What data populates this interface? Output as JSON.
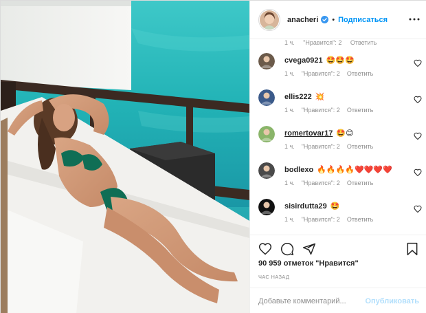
{
  "post": {
    "author": "anacheri",
    "follow_label": "Подписаться",
    "separator": "•",
    "likes_text": "90 959 отметок \"Нравится\"",
    "time_text": "час назад",
    "comment_placeholder": "Добавьте комментарий...",
    "publish_label": "Опубликовать"
  },
  "partial_comment": {
    "time": "1 ч.",
    "likes": "\"Нравится\": 2",
    "reply": "Ответить"
  },
  "comments": [
    {
      "user": "cvega0921",
      "emoji": "🤩🤩🤩",
      "time": "1 ч.",
      "likes": "\"Нравится\": 2",
      "reply": "Ответить",
      "avatar_color": "#6b5a4a",
      "underline": false
    },
    {
      "user": "ellis222",
      "emoji": "💥",
      "time": "1 ч.",
      "likes": "\"Нравится\": 2",
      "reply": "Ответить",
      "avatar_color": "#3b5a8a",
      "underline": false
    },
    {
      "user": "romertovar17",
      "emoji": "🤩😊",
      "time": "1 ч.",
      "likes": "\"Нравится\": 2",
      "reply": "Ответить",
      "avatar_color": "#8ab56a",
      "underline": true
    },
    {
      "user": "bodlexo",
      "emoji": "🔥🔥🔥🔥❤️❤️❤️❤️",
      "time": "1 ч.",
      "likes": "\"Нравится\": 2",
      "reply": "Ответить",
      "avatar_color": "#4a4a4a",
      "underline": false
    },
    {
      "user": "sisirdutta29",
      "emoji": "🤩",
      "time": "1 ч.",
      "likes": "\"Нравится\": 2",
      "reply": "Ответить",
      "avatar_color": "#111111",
      "underline": false
    }
  ],
  "icons": {
    "verified": "verified-badge-icon",
    "more": "more-options-icon",
    "like": "heart-icon",
    "comment": "comment-icon",
    "share": "share-icon",
    "save": "bookmark-icon"
  },
  "colors": {
    "accent": "#0095f6",
    "muted": "#8e8e8e",
    "publish_disabled": "#b2dffc",
    "sea": "#2bb6b9"
  }
}
